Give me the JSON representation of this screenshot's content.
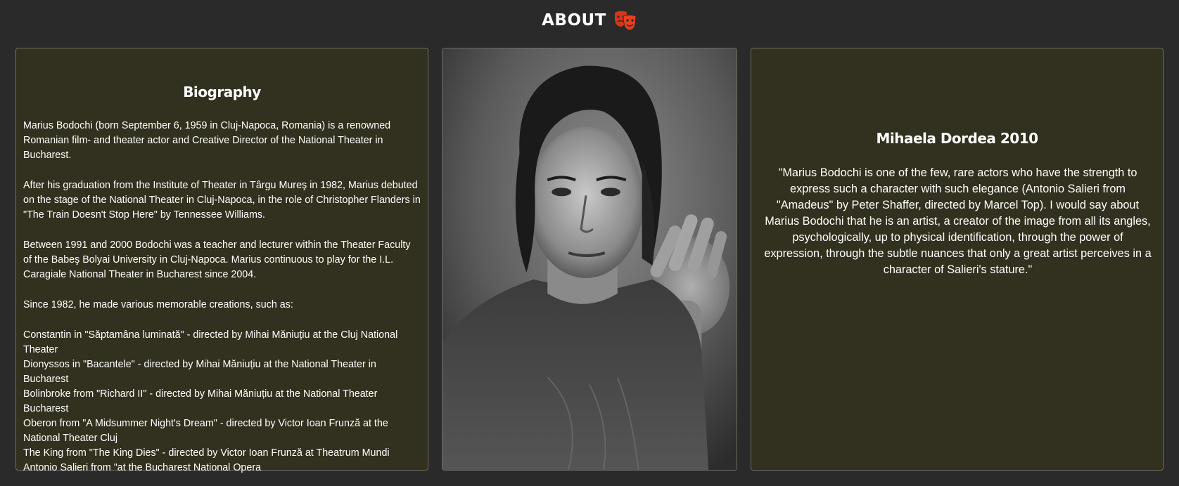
{
  "header": {
    "title": "ABOUT",
    "icon": "theater-masks-icon",
    "icon_color": "#e03a1e"
  },
  "biography": {
    "title": "Biography",
    "paragraphs": [
      "Marius Bodochi (born September 6, 1959 in Cluj-Napoca, Romania) is a renowned Romanian film- and theater actor and Creative Director of the National Theater in Bucharest.",
      "After his graduation from the Institute of Theater in Târgu Mureş in 1982, Marius debuted on the stage of the National Theater in Cluj-Napoca, in the role of Christopher Flanders in \"The Train Doesn't Stop Here\" by Tennessee Williams.",
      "Between 1991 and 2000 Bodochi was a teacher and lecturer within the Theater Faculty of the Babeş Bolyai University in Cluj-Napoca. Marius continuous to play for the I.L. Caragiale National Theater in Bucharest since 2004.",
      "Since 1982, he made various memorable creations, such as:"
    ],
    "roles": [
      "Constantin in \"Săptamâna luminată\" - directed by Mihai Măniuțiu at the Cluj National Theater",
      "Dionyssos in \"Bacantele\" - directed by Mihai Măniuțiu at the National Theater in Bucharest",
      "Bolinbroke from \"Richard II\" - directed by Mihai Măniuțiu at the National Theater Bucharest",
      "Oberon from \"A Midsummer Night's Dream\" - directed by Victor Ioan Frunză at the National Theater Cluj",
      "The King from \"The King Dies\" - directed by Victor Ioan Frunză at Theatrum Mundi",
      "Antonio Salieri from \"at the Bucharest National Opera"
    ]
  },
  "photo": {
    "subject": "black-and-white portrait photo"
  },
  "quote": {
    "title": "Mihaela Dordea 2010",
    "text": "\"Marius Bodochi is one of the few, rare actors who have the strength to express such a character with such elegance (Antonio Salieri from \"Amadeus\" by Peter Shaffer, directed by Marcel Top). I would say about Marius Bodochi that he is an artist, a creator of the image from all its angles, psychologically, up to physical identification, through the power of expression, through the subtle nuances that only a great artist perceives in a character of Salieri's stature.\""
  },
  "colors": {
    "page_background": "#2a2a2a",
    "card_background": "#32301e",
    "card_border": "#6e6c60",
    "text": "#ffffff"
  }
}
